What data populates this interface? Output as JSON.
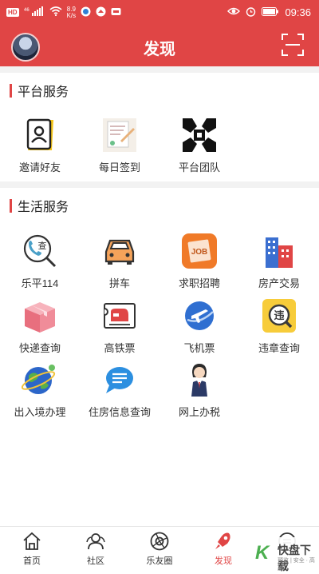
{
  "status_bar": {
    "left_chip": "HD",
    "network_small": "46",
    "speed_value": "8.9",
    "speed_unit": "K/s",
    "time": "09:36"
  },
  "header": {
    "title": "发现"
  },
  "platform": {
    "title": "平台服务",
    "items": [
      {
        "label": "邀请好友"
      },
      {
        "label": "每日签到"
      },
      {
        "label": "平台团队"
      }
    ]
  },
  "life": {
    "title": "生活服务",
    "items": [
      {
        "label": "乐平114"
      },
      {
        "label": "拼车"
      },
      {
        "label": "求职招聘"
      },
      {
        "label": "房产交易"
      },
      {
        "label": "快递查询"
      },
      {
        "label": "高铁票"
      },
      {
        "label": "飞机票"
      },
      {
        "label": "违章查询"
      },
      {
        "label": "出入境办理"
      },
      {
        "label": "住房信息查询"
      },
      {
        "label": "网上办税"
      }
    ],
    "icon_texts": {
      "cha": "查",
      "job": "JOB",
      "wei": "违"
    }
  },
  "tabs": [
    {
      "label": "首页",
      "active": false
    },
    {
      "label": "社区",
      "active": false
    },
    {
      "label": "乐友圈",
      "active": false
    },
    {
      "label": "发现",
      "active": true
    }
  ],
  "watermark": {
    "logo_char": "K",
    "name": "快盘下载",
    "sub": "预览 | 安全 · 高速"
  },
  "colors": {
    "accent": "#e04545"
  }
}
